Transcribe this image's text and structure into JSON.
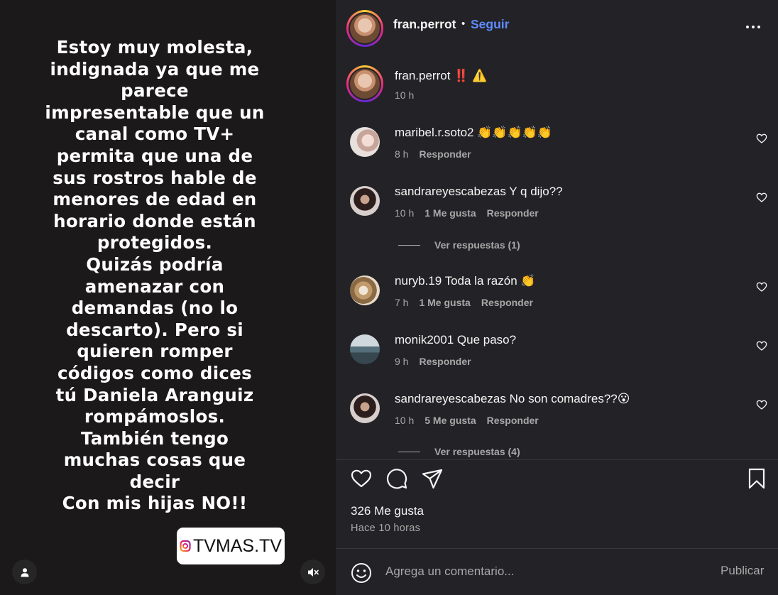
{
  "media": {
    "story_text": "Estoy muy molesta,\nindignada ya que me\nparece\nimpresentable que un\ncanal como TV+\npermita que una de\nsus rostros hable de\nmenores de edad en\nhorario donde están\nprotegidos.\nQuizás podría\namenazar con\ndemandas (no lo\ndescarto). Pero si\nquieren romper\ncódigos como dices\ntú Daniela Aranguiz\nrompámoslos.\nTambién tengo\nmuchas cosas que\ndecir\nCon mis hijas NO!!",
    "watermark": "TVMAS.TV",
    "user_icon": "user-icon",
    "mute_icon": "muted-speaker-icon"
  },
  "header": {
    "username": "fran.perrot",
    "separator": "•",
    "follow_label": "Seguir",
    "more_icon": "more-options-icon"
  },
  "caption": {
    "username": "fran.perrot",
    "text": "‼️ ⚠️",
    "time": "10 h"
  },
  "comments": [
    {
      "username": "maribel.r.soto2",
      "text": "👏👏👏👏👏",
      "time": "8 h",
      "likes": "",
      "reply_label": "Responder",
      "view_replies": ""
    },
    {
      "username": "sandrareyescabezas",
      "text": "Y q dijo??",
      "time": "10 h",
      "likes": "1 Me gusta",
      "reply_label": "Responder",
      "view_replies": "Ver respuestas (1)"
    },
    {
      "username": "nuryb.19",
      "text": "Toda la razón 👏",
      "time": "7 h",
      "likes": "1 Me gusta",
      "reply_label": "Responder",
      "view_replies": ""
    },
    {
      "username": "monik2001",
      "text": "Que paso?",
      "time": "9 h",
      "likes": "",
      "reply_label": "Responder",
      "view_replies": ""
    },
    {
      "username": "sandrareyescabezas",
      "text": "No son comadres??😮",
      "time": "10 h",
      "likes": "5 Me gusta",
      "reply_label": "Responder",
      "view_replies": "Ver respuestas (4)"
    }
  ],
  "actions": {
    "like_icon": "heart-icon",
    "comment_icon": "comment-bubble-icon",
    "share_icon": "paper-plane-icon",
    "save_icon": "bookmark-icon",
    "likes_count": "326 Me gusta",
    "posted_ago": "Hace 10 horas"
  },
  "composer": {
    "emoji_icon": "emoji-icon",
    "placeholder": "Agrega un comentario...",
    "publish_label": "Publicar"
  },
  "colors": {
    "panel_bg": "#232327",
    "media_bg": "#1c191b",
    "accent_blue": "#5f8bff",
    "muted_text": "#a8a8a8"
  }
}
